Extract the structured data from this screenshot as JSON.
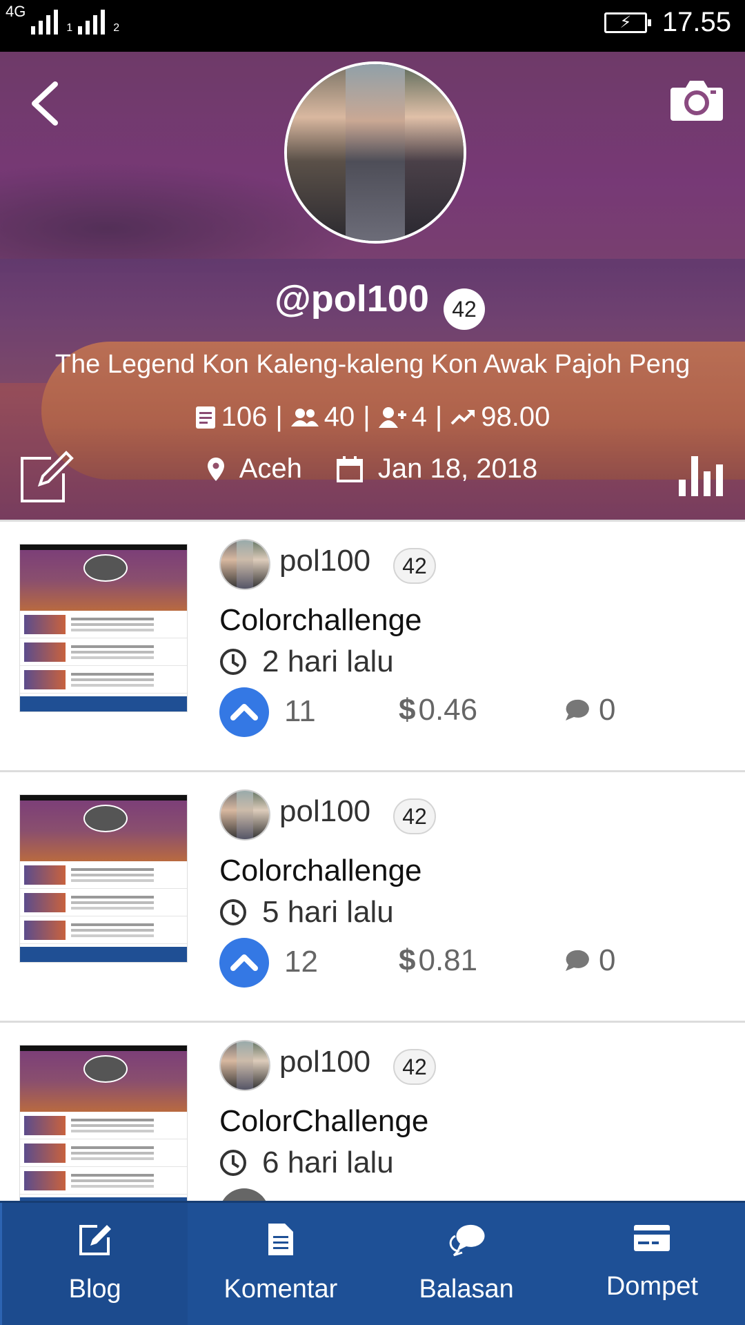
{
  "status_bar": {
    "network": "4G",
    "sim1": "1",
    "sim2": "2",
    "battery_icon": "battery-charging-icon",
    "time": "17.55"
  },
  "profile": {
    "username": "@pol100",
    "reputation": "42",
    "bio": "The Legend Kon Kaleng-kaleng Kon Awak Pajoh Peng",
    "posts": "106",
    "followers": "40",
    "following": "4",
    "power": "98.00",
    "location": "Aceh",
    "joined": "Jan 18, 2018"
  },
  "posts": [
    {
      "author": "pol100",
      "reputation": "42",
      "title": "Colorchallenge",
      "time": "2 hari lalu",
      "votes": "11",
      "payout": "0.46",
      "comments": "0"
    },
    {
      "author": "pol100",
      "reputation": "42",
      "title": "Colorchallenge",
      "time": "5 hari lalu",
      "votes": "12",
      "payout": "0.81",
      "comments": "0"
    },
    {
      "author": "pol100",
      "reputation": "42",
      "title": "ColorChallenge",
      "time": "6 hari lalu",
      "votes": "",
      "payout": "",
      "comments": ""
    }
  ],
  "currency_symbol": "$",
  "bottom_nav": [
    {
      "label": "Blog",
      "icon": "edit-icon"
    },
    {
      "label": "Komentar",
      "icon": "document-icon"
    },
    {
      "label": "Balasan",
      "icon": "chat-bubbles-icon"
    },
    {
      "label": "Dompet",
      "icon": "credit-card-icon"
    }
  ],
  "colors": {
    "nav_bg": "#1e5096",
    "vote_blue": "#3478e4",
    "header_overlay": "#7a3f78"
  }
}
